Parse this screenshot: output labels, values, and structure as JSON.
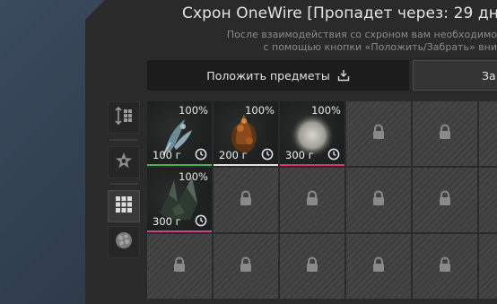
{
  "stash": {
    "title": "Схрон OneWire [Пропадет через: 29 дн.",
    "note_line1": "После взаимодействия со схроном вам необходимо",
    "note_line2": "с помощью кнопки «Положить/Забрать» вни",
    "put_button": "Положить предметы",
    "take_button": "За"
  },
  "side_filters": [
    {
      "name": "sort-icon"
    },
    {
      "name": "star-icon"
    },
    {
      "name": "grid-icon",
      "active": true
    },
    {
      "name": "artifact-icon"
    }
  ],
  "items": [
    {
      "name": "feather-artifact",
      "durability": "100%",
      "weight": "100 г",
      "rarity_color": "#4caf50"
    },
    {
      "name": "flame-artifact",
      "durability": "100%",
      "weight": "200 г",
      "rarity_color": "#e0e0e0"
    },
    {
      "name": "glow-orb-artifact",
      "durability": "100%",
      "weight": "300 г",
      "rarity_color": "#d2386a"
    },
    {
      "name": "crystal-artifact",
      "durability": "100%",
      "weight": "300 г",
      "rarity_color": "#c04a8c"
    }
  ],
  "colors": {
    "panel": "#2a2a2a",
    "locked_slot": "#3e3e3e",
    "text": "#e4e4e4"
  }
}
